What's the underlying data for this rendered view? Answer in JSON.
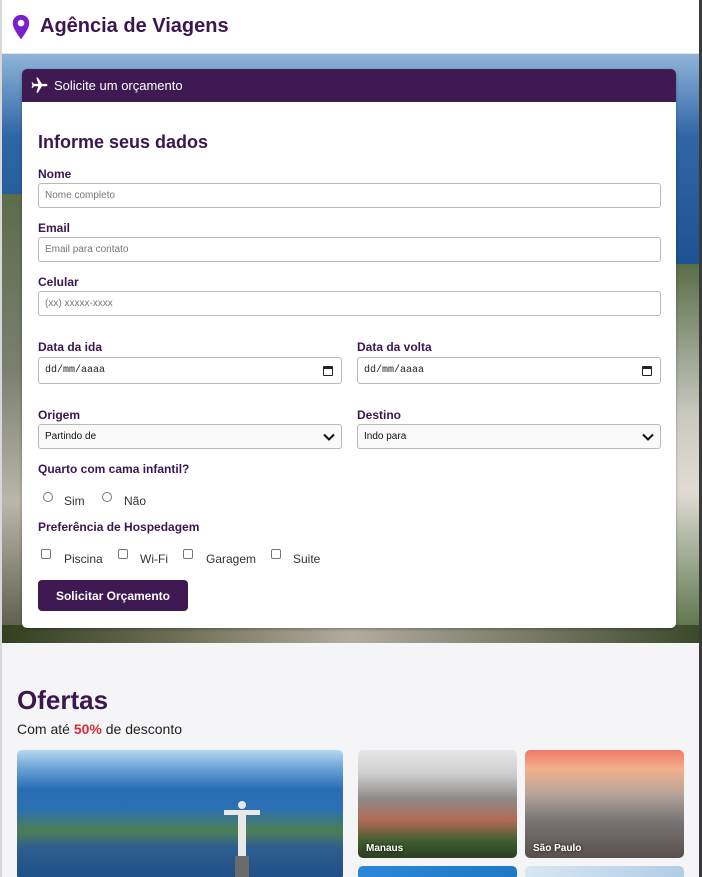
{
  "header": {
    "title": "Agência de Viagens",
    "icon": "map-pin-icon",
    "accent": "#3b1650"
  },
  "form": {
    "card_title": "Solicite um orçamento",
    "heading": "Informe seus dados",
    "fields": {
      "name": {
        "label": "Nome",
        "placeholder": "Nome completo"
      },
      "email": {
        "label": "Email",
        "placeholder": "Email para contato"
      },
      "phone": {
        "label": "Celular",
        "placeholder": "(xx) xxxxx-xxxx"
      },
      "departure_date": {
        "label": "Data da ida",
        "value": "dd/mm/aaaa"
      },
      "return_date": {
        "label": "Data da volta",
        "value": "dd/mm/aaaa"
      },
      "origin": {
        "label": "Origem",
        "value": "Partindo de"
      },
      "destination": {
        "label": "Destino",
        "value": "Indo para"
      }
    },
    "child_bed": {
      "question": "Quarto com cama infantil?",
      "options": [
        "Sim",
        "Não"
      ]
    },
    "lodging": {
      "question": "Preferência de Hospedagem",
      "options": [
        "Piscina",
        "Wi-Fi",
        "Garagem",
        "Suite"
      ]
    },
    "submit_label": "Solicitar Orçamento",
    "button_color": "#3f1a52"
  },
  "offers": {
    "title": "Ofertas",
    "subtitle_prefix": "Com até ",
    "discount": "50%",
    "subtitle_suffix": " de desconto",
    "cities": [
      "Manaus",
      "São Paulo"
    ]
  }
}
